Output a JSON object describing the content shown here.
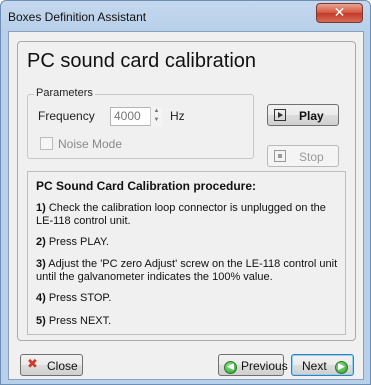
{
  "window": {
    "title": "Boxes Definition Assistant",
    "close_glyph": "✕"
  },
  "heading": "PC sound card calibration",
  "parameters": {
    "legend": "Parameters",
    "frequency_label": "Frequency",
    "frequency_value": "4000",
    "unit": "Hz",
    "noise_mode_label": "Noise Mode",
    "noise_mode_checked": false
  },
  "buttons": {
    "play": "Play",
    "stop": "Stop",
    "close": "Close",
    "previous": "Previous",
    "next": "Next"
  },
  "procedure": {
    "title": "PC Sound Card Calibration procedure:",
    "steps": [
      {
        "num": "1)",
        "text": " Check the calibration loop connector is unplugged on the LE-118 control unit."
      },
      {
        "num": "2)",
        "text": " Press PLAY."
      },
      {
        "num": "3)",
        "text": " Adjust the 'PC zero Adjust' screw on the LE-118 control  unit until the galvanometer indicates the 100% value."
      },
      {
        "num": "4)",
        "text": " Press STOP."
      },
      {
        "num": "5)",
        "text": " Press NEXT."
      }
    ]
  },
  "icons": {
    "play": "play-icon",
    "stop": "stop-icon",
    "close": "close-icon",
    "previous": "arrow-left-icon",
    "next": "arrow-right-icon",
    "spin": "spinner-icon"
  },
  "colors": {
    "title_bar": "#b9d0ea",
    "close_button": "#c2392a",
    "panel": "#f0f0f0",
    "focus_border": "#3c7fb1"
  }
}
